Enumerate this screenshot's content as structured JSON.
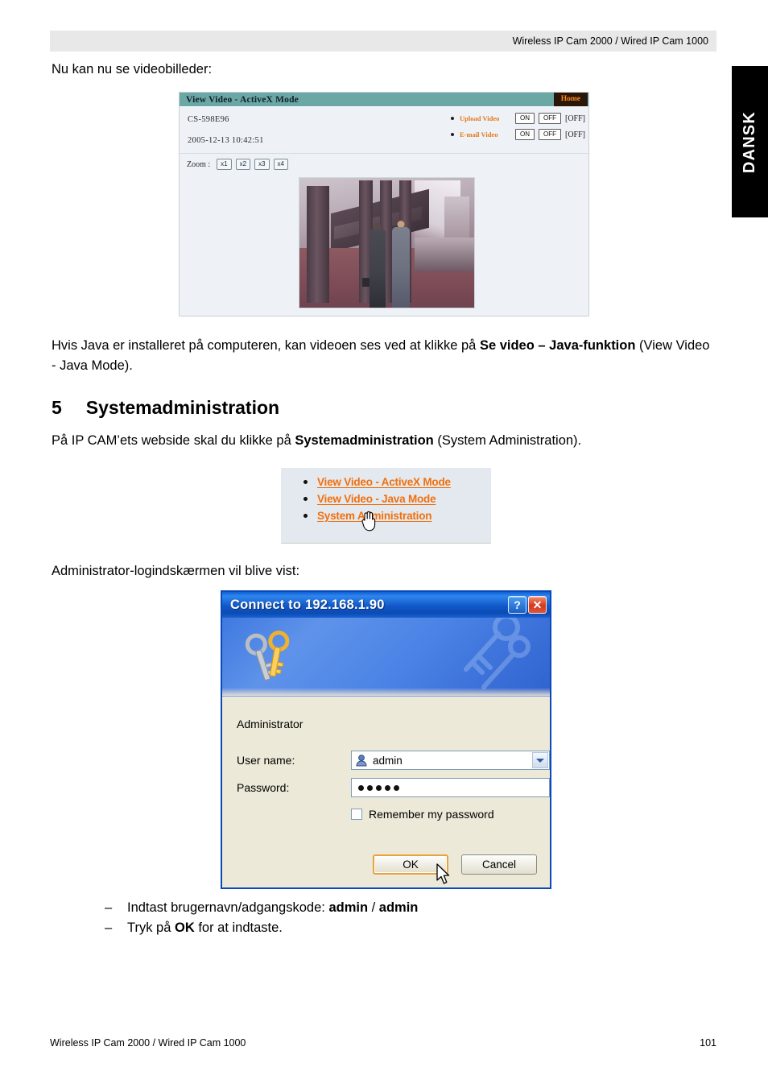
{
  "page": {
    "header_text": "Wireless IP Cam 2000 / Wired IP Cam 1000",
    "side_tab": "DANSK",
    "footer_left": "Wireless IP Cam 2000 / Wired IP Cam 1000",
    "footer_page": "101"
  },
  "body": {
    "intro": "Nu kan nu se videobilleder:",
    "java_note_pre": "Hvis Java er installeret på computeren, kan videoen ses ved at klikke på ",
    "java_note_bold": "Se video – Java-funktion",
    "java_note_post": " (View Video - Java Mode).",
    "section_number": "5",
    "section_title": "Systemadministration",
    "sysadmin_pre": "På IP CAM’ets webside skal du klikke på ",
    "sysadmin_bold": "Systemadministration",
    "sysadmin_post": " (System Administration).",
    "login_intro": "Administrator-logindskærmen vil blive vist:",
    "steps": [
      {
        "mark": "–",
        "pre": "Indtast brugernavn/adgangskode: ",
        "bold1": "admin",
        "mid": " / ",
        "bold2": "admin",
        "post": ""
      },
      {
        "mark": "–",
        "pre": "Tryk på ",
        "bold1": "OK",
        "mid": "",
        "bold2": "",
        "post": " for at indtaste."
      }
    ]
  },
  "video_viewer": {
    "title": "View Video - ActiveX Mode",
    "home_label": "Home",
    "camera_id": "CS-598E96",
    "timestamp": "2005-12-13 10:42:51",
    "actions": [
      {
        "label": "Upload Video",
        "on": "ON",
        "off": "OFF",
        "state": "[OFF]"
      },
      {
        "label": "E-mail Video",
        "on": "ON",
        "off": "OFF",
        "state": "[OFF]"
      }
    ],
    "zoom_label": "Zoom :",
    "zoom_levels": [
      "x1",
      "x2",
      "x3",
      "x4"
    ]
  },
  "menu_panel": {
    "links": [
      "View Video - ActiveX Mode",
      "View Video - Java Mode",
      "System Administration"
    ],
    "link_color": "#f26f0c",
    "cursor": "hand-cursor"
  },
  "login_dialog": {
    "title": "Connect to 192.168.1.90",
    "help_label": "?",
    "close_label": "✕",
    "realm": "Administrator",
    "username_label": "User name:",
    "username_value": "admin",
    "password_label": "Password:",
    "password_value": "•••••",
    "password_dots": 5,
    "remember_label": "Remember my password",
    "remember_checked": false,
    "ok_label": "OK",
    "cancel_label": "Cancel",
    "default_button": "OK",
    "titlebar_color": "#1158c8"
  }
}
